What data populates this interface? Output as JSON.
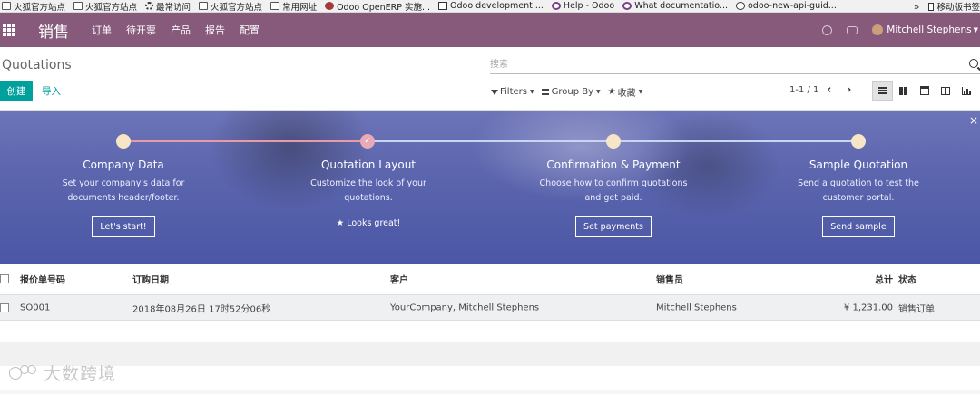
{
  "bookmarks": {
    "items": [
      {
        "label": "火狐官方站点",
        "icon": "folder-icon"
      },
      {
        "label": "火狐官方站点",
        "icon": "folder-icon"
      },
      {
        "label": "最常访问",
        "icon": "gear-icon"
      },
      {
        "label": "火狐官方站点",
        "icon": "folder-icon"
      },
      {
        "label": "常用网址",
        "icon": "folder-icon"
      },
      {
        "label": "Odoo OpenERP 实施...",
        "icon": "odoo-icon"
      },
      {
        "label": "Odoo development ...",
        "icon": "doc-icon"
      },
      {
        "label": "Help - Odoo",
        "icon": "ring-icon"
      },
      {
        "label": "What documentatio...",
        "icon": "ring-icon"
      },
      {
        "label": "odoo-new-api-guid...",
        "icon": "globe-icon"
      }
    ],
    "overflow": "»",
    "mobile": "移动版书签"
  },
  "navbar": {
    "brand": "销售",
    "menu": [
      "订单",
      "待开票",
      "产品",
      "报告",
      "配置"
    ],
    "user": "Mitchell Stephens",
    "accent": "#875a7b"
  },
  "control": {
    "title": "Quotations",
    "search_placeholder": "搜索",
    "create": "创建",
    "import": "导入",
    "filters": "Filters",
    "group_by": "Group By",
    "favorites": "收藏",
    "pager": "1-1 / 1",
    "prev": "‹",
    "next": "›"
  },
  "banner": {
    "close": "×",
    "steps": [
      {
        "title": "Company Data",
        "desc1": "Set your company's data for",
        "desc2": "documents header/footer.",
        "button": "Let's start!",
        "done": false
      },
      {
        "title": "Quotation Layout",
        "desc1": "Customize the look of your",
        "desc2": "quotations.",
        "done_text": "★ Looks great!",
        "done": true
      },
      {
        "title": "Confirmation & Payment",
        "desc1": "Choose how to confirm quotations",
        "desc2": "and get paid.",
        "button": "Set payments",
        "done": false
      },
      {
        "title": "Sample Quotation",
        "desc1": "Send a quotation to test the",
        "desc2": "customer portal.",
        "button": "Send sample",
        "done": false
      }
    ]
  },
  "table": {
    "headers": {
      "number": "报价单号码",
      "date": "订购日期",
      "customer": "客户",
      "salesperson": "销售员",
      "total": "总计",
      "status": "状态"
    },
    "rows": [
      {
        "number": "SO001",
        "date": "2018年08月26日 17时52分06秒",
        "customer": "YourCompany, Mitchell Stephens",
        "salesperson": "Mitchell Stephens",
        "total": "¥ 1,231.00",
        "status": "销售订单"
      }
    ]
  },
  "watermark": "大数跨境"
}
